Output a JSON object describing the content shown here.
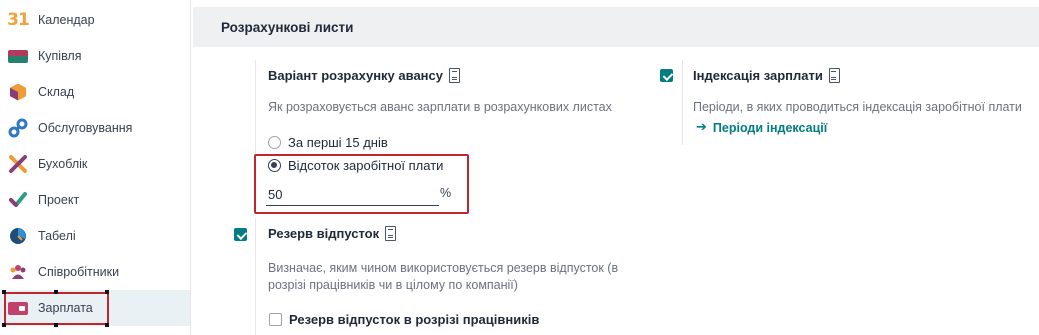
{
  "sidebar": {
    "items": [
      {
        "label": "Календар",
        "icon": "calendar-icon",
        "icon_text": "31"
      },
      {
        "label": "Купівля",
        "icon": "purchase-icon"
      },
      {
        "label": "Склад",
        "icon": "inventory-icon"
      },
      {
        "label": "Обслуговування",
        "icon": "maintenance-icon"
      },
      {
        "label": "Бухоблік",
        "icon": "accounting-icon"
      },
      {
        "label": "Проект",
        "icon": "project-icon"
      },
      {
        "label": "Табелі",
        "icon": "timesheets-icon"
      },
      {
        "label": "Співробітники",
        "icon": "employees-icon"
      },
      {
        "label": "Зарплата",
        "icon": "payroll-icon",
        "active": true
      }
    ]
  },
  "section": {
    "title": "Розрахункові листи"
  },
  "advance": {
    "title": "Варіант розрахунку авансу",
    "description": "Як розраховується аванс зарплати в розрахункових листах",
    "options": [
      {
        "label": "За перші 15 днів",
        "selected": false
      },
      {
        "label": "Відсоток заробітної плати",
        "selected": true
      }
    ],
    "percent_value": "50",
    "percent_sign": "%"
  },
  "indexation": {
    "title": "Індексація зарплати",
    "checked": true,
    "description": "Періоди, в яких проводиться індексація заробітної плати",
    "link_label": "Періоди індексації"
  },
  "vacation": {
    "title": "Резерв відпусток",
    "checked": true,
    "description_line1": "Визначає, яким чином використовується резерв відпусток (в",
    "description_line2": "розрізі працівників чи в цілому по компанії)",
    "sub_option_label": "Резерв відпусток в розрізі працівників",
    "sub_option_checked": false
  },
  "colors": {
    "accent": "#017e84",
    "highlight": "#c0262d",
    "header_bg": "#eef0f2"
  }
}
